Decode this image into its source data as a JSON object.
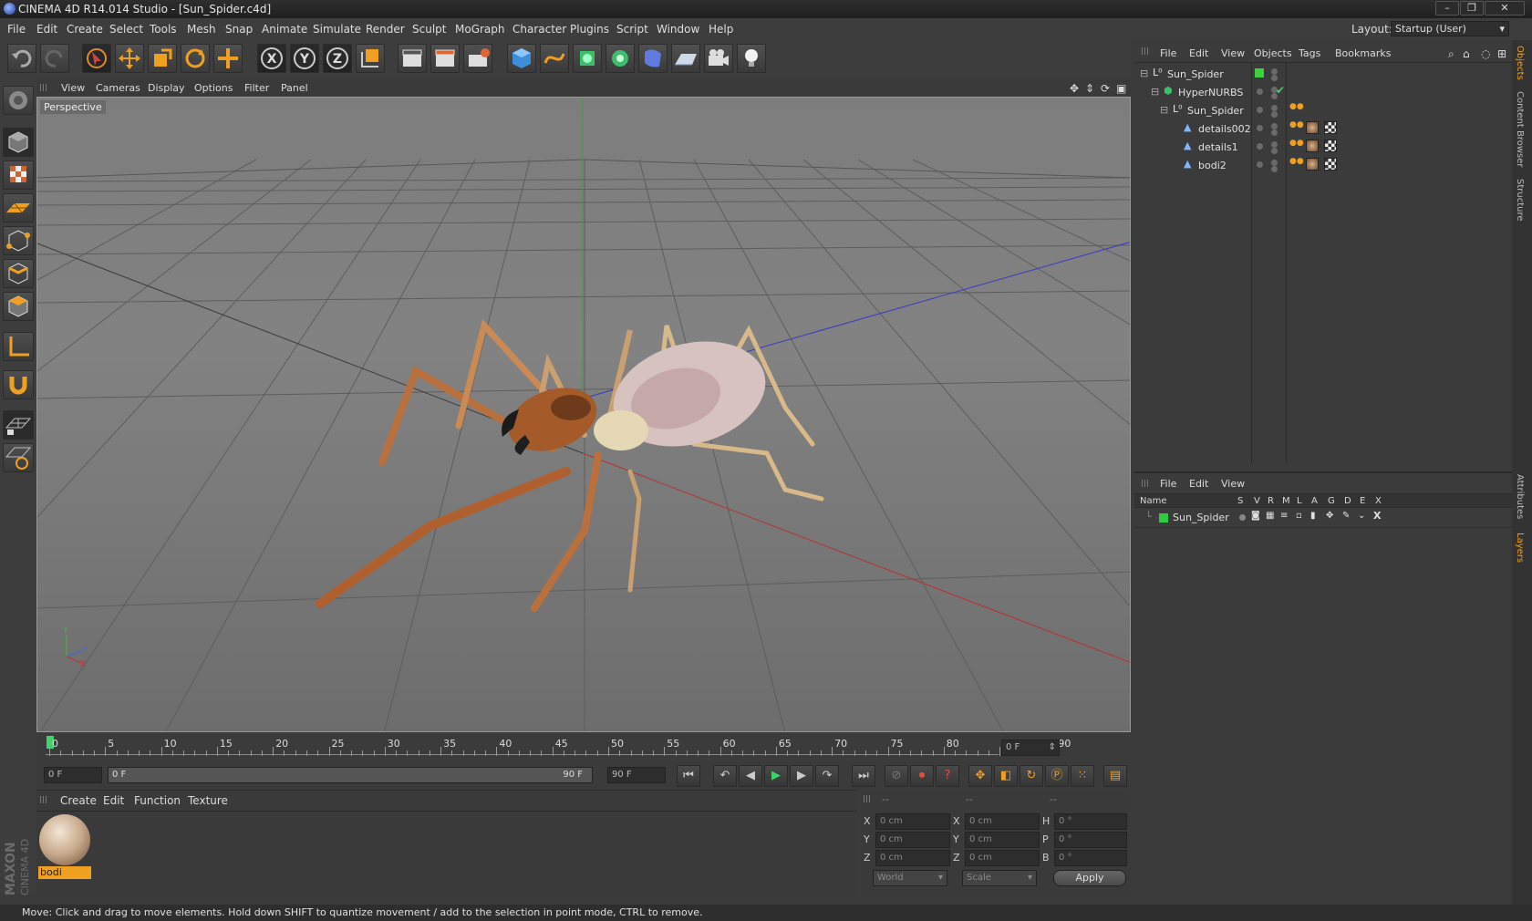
{
  "window": {
    "title": "CINEMA 4D R14.014 Studio - [Sun_Spider.c4d]"
  },
  "menubar": {
    "items": [
      "File",
      "Edit",
      "Create",
      "Select",
      "Tools",
      "Mesh",
      "Snap",
      "Animate",
      "Simulate",
      "Render",
      "Sculpt",
      "MoGraph",
      "Character",
      "Plugins",
      "Script",
      "Window",
      "Help"
    ],
    "layout_label": "Layout:",
    "layout_value": "Startup (User)"
  },
  "viewport": {
    "menus": [
      "View",
      "Cameras",
      "Display",
      "Options",
      "Filter",
      "Panel"
    ],
    "label": "Perspective"
  },
  "timeline": {
    "ticks": [
      "0",
      "5",
      "10",
      "15",
      "20",
      "25",
      "30",
      "35",
      "40",
      "45",
      "50",
      "55",
      "60",
      "65",
      "70",
      "75",
      "80",
      "85",
      "90"
    ],
    "current_frame": "0 F"
  },
  "transport": {
    "start_field": "0 F",
    "range_start": "0 F",
    "range_end": "90 F",
    "end_field": "90 F"
  },
  "material_manager": {
    "menus": [
      "Create",
      "Edit",
      "Function",
      "Texture"
    ],
    "materials": [
      {
        "name": "bodi"
      }
    ]
  },
  "coords": {
    "headers": [
      "--",
      "--",
      "--"
    ],
    "rows": [
      {
        "a": "X",
        "av": "0 cm",
        "b": "X",
        "bv": "0 cm",
        "c": "H",
        "cv": "0 °"
      },
      {
        "a": "Y",
        "av": "0 cm",
        "b": "Y",
        "bv": "0 cm",
        "c": "P",
        "cv": "0 °"
      },
      {
        "a": "Z",
        "av": "0 cm",
        "b": "Z",
        "bv": "0 cm",
        "c": "B",
        "cv": "0 °"
      }
    ],
    "mode1": "World",
    "mode2": "Scale",
    "apply": "Apply"
  },
  "object_manager": {
    "menus": [
      "File",
      "Edit",
      "View",
      "Objects",
      "Tags",
      "Bookmarks"
    ],
    "objects": [
      {
        "name": "Sun_Spider"
      },
      {
        "name": "HyperNURBS"
      },
      {
        "name": "Sun_Spider"
      },
      {
        "name": "details002"
      },
      {
        "name": "details1"
      },
      {
        "name": "bodi2"
      }
    ]
  },
  "layer_manager": {
    "menus": [
      "File",
      "Edit",
      "View"
    ],
    "columns": [
      "Name",
      "S",
      "V",
      "R",
      "M",
      "L",
      "A",
      "G",
      "D",
      "E",
      "X"
    ],
    "layers": [
      {
        "name": "Sun_Spider",
        "color": "#2ecc40"
      }
    ]
  },
  "side_tabs": [
    "Objects",
    "Content Browser",
    "Structure",
    "Attributes",
    "Layers"
  ],
  "brand": {
    "maxon": "MAXON",
    "c4d": "CINEMA 4D"
  },
  "status": "Move: Click and drag to move elements. Hold down SHIFT to quantize movement / add to the selection in point mode, CTRL to remove."
}
